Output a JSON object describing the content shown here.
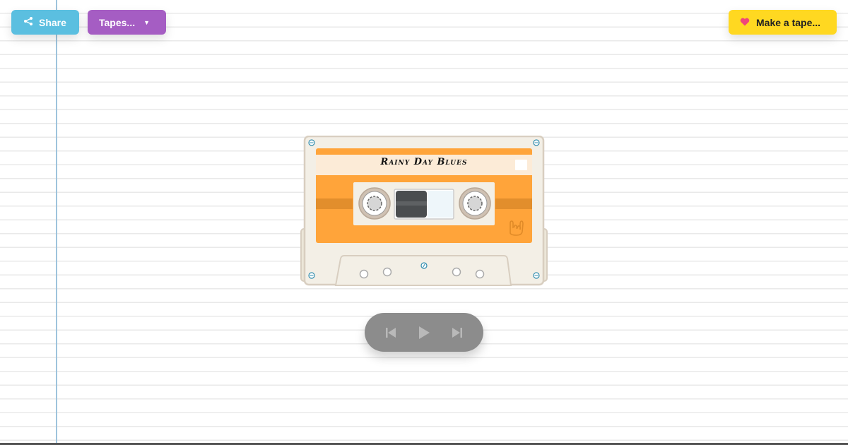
{
  "toolbar": {
    "share_label": "Share",
    "tapes_label": "Tapes...",
    "make_tape_label": "Make a tape..."
  },
  "cassette": {
    "title": "Rainy Day Blues"
  },
  "player": {
    "controls": [
      "previous-icon",
      "play-icon",
      "next-icon"
    ]
  },
  "colors": {
    "share_button": "#5bbfe0",
    "tapes_button": "#a55dc3",
    "make_tape_button": "#ffd821",
    "heart": "#f0457a",
    "cassette_shell": "#f3efe6",
    "cassette_label": "#ffa43a",
    "player_background": "#8c8c8c"
  }
}
